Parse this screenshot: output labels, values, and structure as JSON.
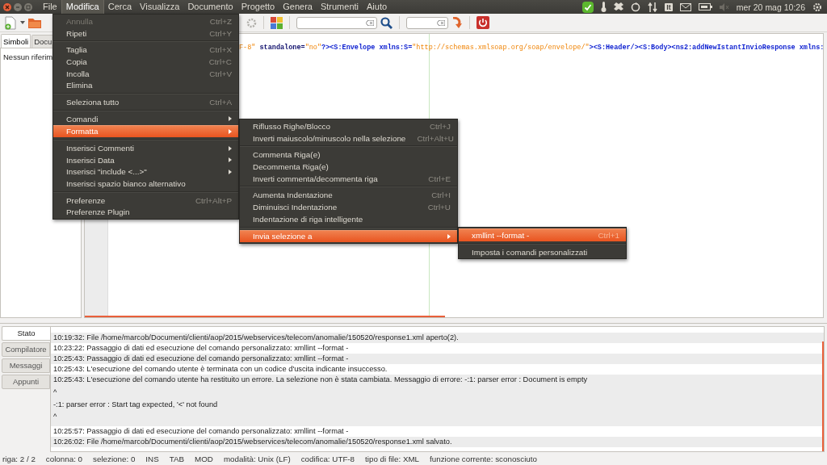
{
  "top_panel": {
    "menus": [
      {
        "label": "File",
        "selected": false
      },
      {
        "label": "Modifica",
        "selected": true
      },
      {
        "label": "Cerca",
        "selected": false
      },
      {
        "label": "Visualizza",
        "selected": false
      },
      {
        "label": "Documento",
        "selected": false
      },
      {
        "label": "Progetto",
        "selected": false
      },
      {
        "label": "Genera",
        "selected": false
      },
      {
        "label": "Strumenti",
        "selected": false
      },
      {
        "label": "Aiuto",
        "selected": false
      }
    ],
    "keyboard_layout": "It",
    "clock": "mer 20 mag 10:26"
  },
  "sidebar": {
    "tabs": [
      {
        "label": "Simboli",
        "selected": true
      },
      {
        "label": "Docu",
        "selected": false
      }
    ],
    "message": "Nessun riferim"
  },
  "editor": {
    "tokens": [
      {
        "kind": "value",
        "text": "F-8\""
      },
      {
        "kind": "attr",
        "text": " standalone="
      },
      {
        "kind": "value",
        "text": "\"no\""
      },
      {
        "kind": "tag",
        "text": "?><S:Envelope xmlns:S="
      },
      {
        "kind": "value",
        "text": "\"http://schemas.xmlsoap.org/soap/envelope/\""
      },
      {
        "kind": "tag",
        "text": "><S:Header/><S:Body><ns2:addNewIstantInvioResponse xmlns:"
      }
    ]
  },
  "edit_menu": {
    "groups": [
      [
        {
          "label": "Annulla",
          "shortcut": "Ctrl+Z",
          "disabled": true,
          "submenu": false,
          "selected": false
        },
        {
          "label": "Ripeti",
          "shortcut": "Ctrl+Y",
          "disabled": false,
          "submenu": false,
          "selected": false
        }
      ],
      [
        {
          "label": "Taglia",
          "shortcut": "Ctrl+X",
          "disabled": false,
          "submenu": false,
          "selected": false
        },
        {
          "label": "Copia",
          "shortcut": "Ctrl+C",
          "disabled": false,
          "submenu": false,
          "selected": false
        },
        {
          "label": "Incolla",
          "shortcut": "Ctrl+V",
          "disabled": false,
          "submenu": false,
          "selected": false
        },
        {
          "label": "Elimina",
          "disabled": false,
          "submenu": false,
          "selected": false
        }
      ],
      [
        {
          "label": "Seleziona tutto",
          "shortcut": "Ctrl+A",
          "disabled": false,
          "submenu": false,
          "selected": false
        }
      ],
      [
        {
          "label": "Comandi",
          "disabled": false,
          "submenu": true,
          "selected": false
        },
        {
          "label": "Formatta",
          "disabled": false,
          "submenu": true,
          "selected": true
        }
      ],
      [
        {
          "label": "Inserisci Commenti",
          "disabled": false,
          "submenu": true,
          "selected": false
        },
        {
          "label": "Inserisci Data",
          "disabled": false,
          "submenu": true,
          "selected": false
        },
        {
          "label": "Inserisci \"include <...>\"",
          "disabled": false,
          "submenu": true,
          "selected": false
        },
        {
          "label": "Inserisci spazio bianco alternativo",
          "disabled": false,
          "submenu": false,
          "selected": false
        }
      ],
      [
        {
          "label": "Preferenze",
          "shortcut": "Ctrl+Alt+P",
          "disabled": false,
          "submenu": false,
          "selected": false
        },
        {
          "label": "Preferenze Plugin",
          "disabled": false,
          "submenu": false,
          "selected": false
        }
      ]
    ]
  },
  "format_menu": {
    "groups": [
      [
        {
          "label": "Riflusso Righe/Blocco",
          "shortcut": "Ctrl+J",
          "disabled": false,
          "submenu": false,
          "selected": false
        },
        {
          "label": "Inverti maiuscolo/minuscolo nella selezione",
          "shortcut": "Ctrl+Alt+U",
          "disabled": false,
          "submenu": false,
          "selected": false
        }
      ],
      [
        {
          "label": "Commenta Riga(e)",
          "disabled": false,
          "submenu": false,
          "selected": false
        },
        {
          "label": "Decommenta Riga(e)",
          "disabled": false,
          "submenu": false,
          "selected": false
        },
        {
          "label": "Inverti commenta/decommenta riga",
          "shortcut": "Ctrl+E",
          "disabled": false,
          "submenu": false,
          "selected": false
        }
      ],
      [
        {
          "label": "Aumenta Indentazione",
          "shortcut": "Ctrl+I",
          "disabled": false,
          "submenu": false,
          "selected": false
        },
        {
          "label": "Diminuisci Indentazione",
          "shortcut": "Ctrl+U",
          "disabled": false,
          "submenu": false,
          "selected": false
        },
        {
          "label": "Indentazione di riga intelligente",
          "disabled": false,
          "submenu": false,
          "selected": false
        }
      ],
      [
        {
          "label": "Invia selezione a",
          "disabled": false,
          "submenu": true,
          "selected": true
        }
      ]
    ]
  },
  "send_menu": {
    "groups": [
      [
        {
          "label": "xmllint --format -",
          "shortcut": "Ctrl+1",
          "disabled": false,
          "submenu": false,
          "selected": true
        }
      ],
      [
        {
          "label": "Imposta i comandi personalizzati",
          "disabled": false,
          "submenu": false,
          "selected": false
        }
      ]
    ]
  },
  "log_panel": {
    "tabs": [
      {
        "label": "Stato",
        "selected": true
      },
      {
        "label": "Compilatore",
        "selected": false
      },
      {
        "label": "Messaggi",
        "selected": false
      },
      {
        "label": "Appunti",
        "selected": false
      }
    ],
    "entries": [
      {
        "lines": [
          "10:19:32: File /home/marcob/Documenti/clienti/aop/2015/webservices/telecom/anomalie/150520/response1.xml aperto(2)."
        ]
      },
      {
        "lines": [
          "10:23:22: Passaggio di dati ed esecuzione del comando personalizzato: xmllint --format -"
        ]
      },
      {
        "lines": [
          "10:25:43: Passaggio di dati ed esecuzione del comando personalizzato: xmllint --format -"
        ]
      },
      {
        "lines": [
          "10:25:43: L'esecuzione del comando utente è terminata con un codice d'uscita indicante insuccesso."
        ]
      },
      {
        "lines": [
          "10:25:43: L'esecuzione del comando utente ha restituito un errore. La selezione non è stata cambiata. Messaggio di errore: -:1: parser error : Document is empty",
          "^",
          "-:1: parser error : Start tag expected, '<' not found",
          "^"
        ]
      },
      {
        "lines": [
          "10:25:57: Passaggio di dati ed esecuzione del comando personalizzato: xmllint --format -"
        ]
      },
      {
        "lines": [
          "10:26:02: File /home/marcob/Documenti/clienti/aop/2015/webservices/telecom/anomalie/150520/response1.xml salvato."
        ]
      }
    ]
  },
  "status_bar": [
    "riga: 2 / 2",
    "colonna: 0",
    "selezione: 0",
    "INS",
    "TAB",
    "MOD",
    "modalità: Unix (LF)",
    "codifica: UTF-8",
    "tipo di file: XML",
    "funzione corrente: sconosciuto"
  ]
}
